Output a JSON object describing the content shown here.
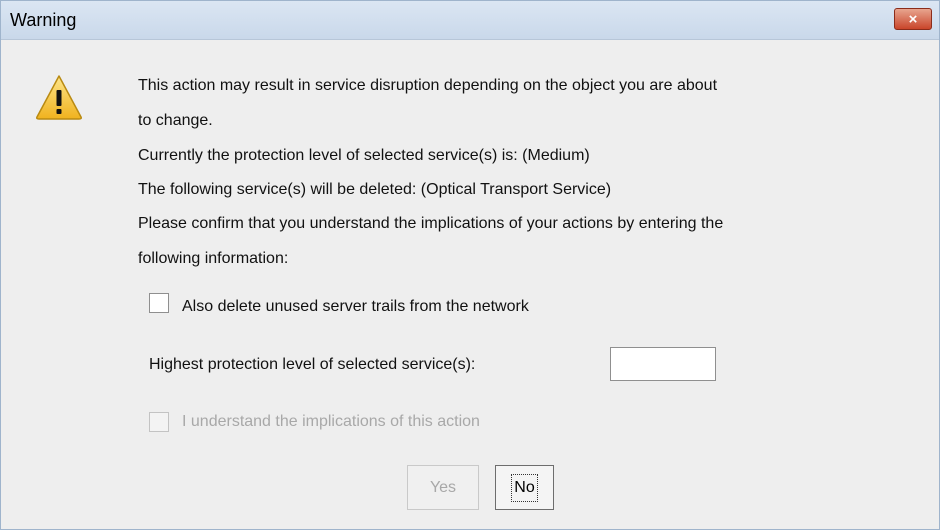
{
  "window": {
    "title": "Warning",
    "close_icon": "×"
  },
  "message": {
    "line1": "This action may result in service disruption depending on the object you are about",
    "line2": "to change.",
    "line3": "Currently the protection level of selected service(s) is: (Medium)",
    "line4": "The following service(s) will be deleted: (Optical Transport Service)",
    "line5": "Please confirm that you understand the implications of your actions by entering the",
    "line6": "following information:"
  },
  "options": {
    "delete_trails_label": "Also delete unused server trails from the network",
    "delete_trails_checked": false,
    "protection_label": "Highest protection level of selected service(s):",
    "protection_value": "",
    "understand_label": "I understand the implications of this action",
    "understand_checked": false,
    "understand_enabled": false
  },
  "buttons": {
    "yes_label": "Yes",
    "yes_enabled": false,
    "no_label": "No"
  },
  "colors": {
    "titlebar": "#c9d8ea",
    "close_button": "#c9452a",
    "warning_icon_fill": "#f6c33b",
    "disabled_text": "#a8a8a8"
  }
}
